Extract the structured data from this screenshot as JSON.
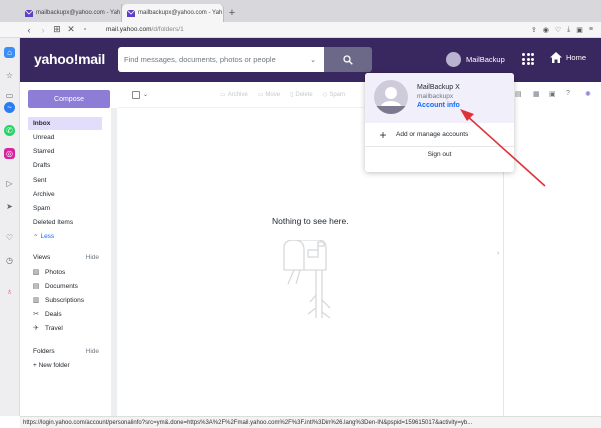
{
  "browser": {
    "tabs": [
      {
        "title": "mailbackupx@yahoo.com - Yah",
        "active": false
      },
      {
        "title": "mailbackupx@yahoo.com - Yah",
        "active": true
      }
    ],
    "url_host": "mail.yahoo.com",
    "url_path": "/d/folders/1",
    "status_url": "https://login.yahoo.com/account/personalinfo?src=ym&.done=https%3A%2F%2Fmail.yahoo.com%2F%3F.intl%3Din%26.lang%3Den-IN&pspid=159615017&activity=yb..."
  },
  "header": {
    "logo": "yahoo!mail",
    "search_placeholder": "Find messages, documents, photos or people",
    "account_name": "MailBackup",
    "home_label": "Home"
  },
  "nav": {
    "compose_label": "Compose",
    "folders": [
      "Inbox",
      "Unread",
      "Starred",
      "Drafts",
      "Sent",
      "Archive",
      "Spam",
      "Deleted Items"
    ],
    "less_label": "Less",
    "views_label": "Views",
    "views_hide": "Hide",
    "views": [
      "Photos",
      "Documents",
      "Subscriptions",
      "Deals",
      "Travel"
    ],
    "folders_label": "Folders",
    "folders_hide": "Hide",
    "new_folder": "+ New folder"
  },
  "toolbar": {
    "archive": "Archive",
    "move": "Move",
    "delete": "Delete",
    "spam": "Spam"
  },
  "main": {
    "empty_text": "Nothing to see here."
  },
  "account_menu": {
    "display_name": "MailBackup X",
    "email": "mailbackupx",
    "account_info": "Account info",
    "add_accounts": "Add or manage accounts",
    "sign_out": "Sign out"
  },
  "colors": {
    "header": "#39285f",
    "compose": "#8e7dd6",
    "selected_folder": "#e2ddfa",
    "link": "#0f69ff",
    "arrow": "#e0323a"
  }
}
